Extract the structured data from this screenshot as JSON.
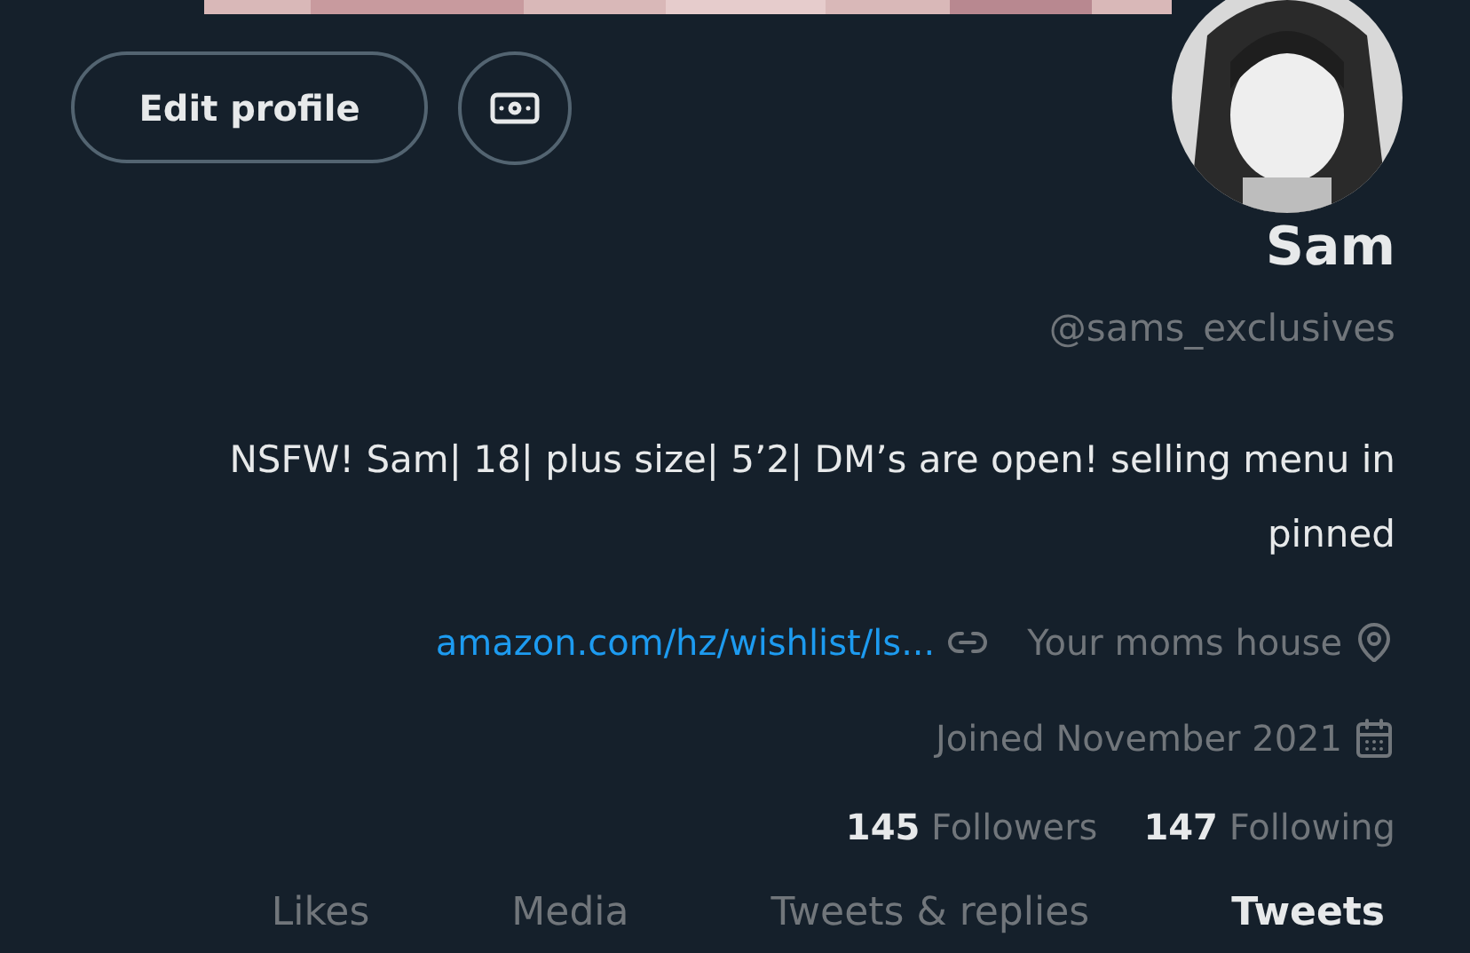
{
  "profile": {
    "name": "Sam",
    "handle": "@sams_exclusives",
    "bio": "NSFW! Sam| 18| plus size| 5’2| DM’s are open! selling menu in pinned",
    "location": "Your moms house",
    "link": "amazon.com/hz/wishlist/ls...",
    "joined": "Joined November 2021"
  },
  "actions": {
    "edit_button": "Edit profile"
  },
  "stats": [
    {
      "count": "145",
      "label": "Followers"
    },
    {
      "count": "147",
      "label": "Following"
    }
  ],
  "tabs": [
    {
      "label": "Likes",
      "selected": false
    },
    {
      "label": "Media",
      "selected": false
    },
    {
      "label": "Tweets & replies",
      "selected": false
    },
    {
      "label": "Tweets",
      "selected": true
    }
  ]
}
